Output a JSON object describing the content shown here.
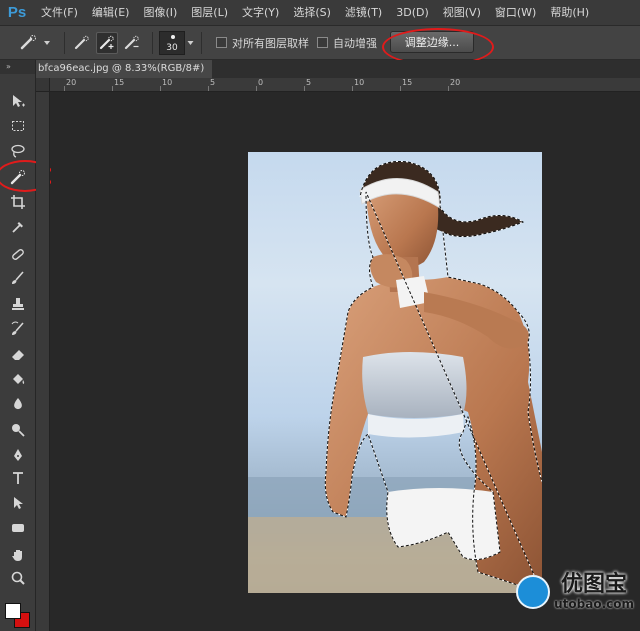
{
  "app": {
    "logo_text": "Ps",
    "menu": [
      "文件(F)",
      "编辑(E)",
      "图像(I)",
      "图层(L)",
      "文字(Y)",
      "选择(S)",
      "滤镜(T)",
      "3D(D)",
      "视图(V)",
      "窗口(W)",
      "帮助(H)"
    ]
  },
  "options": {
    "brush_size": "30",
    "sample_all_layers_label": "对所有图层取样",
    "auto_enhance_label": "自动增强",
    "refine_edge_label": "调整边缘..."
  },
  "toolbar": {
    "collapse_label": "»",
    "active_tool": "quick-selection",
    "foreground_color": "#ffffff",
    "background_color": "#d41010"
  },
  "document": {
    "tab_label": "bfca96eac.jpg @ 8.33%(RGB/8#)",
    "ruler_ticks": [
      "20",
      "15",
      "10",
      "5",
      "0",
      "5",
      "10",
      "15",
      "20"
    ]
  },
  "watermark": {
    "title": "优图宝",
    "url": "utobao.com"
  },
  "colors": {
    "accent": "#3d9bd8",
    "highlight": "#e01b1b"
  }
}
